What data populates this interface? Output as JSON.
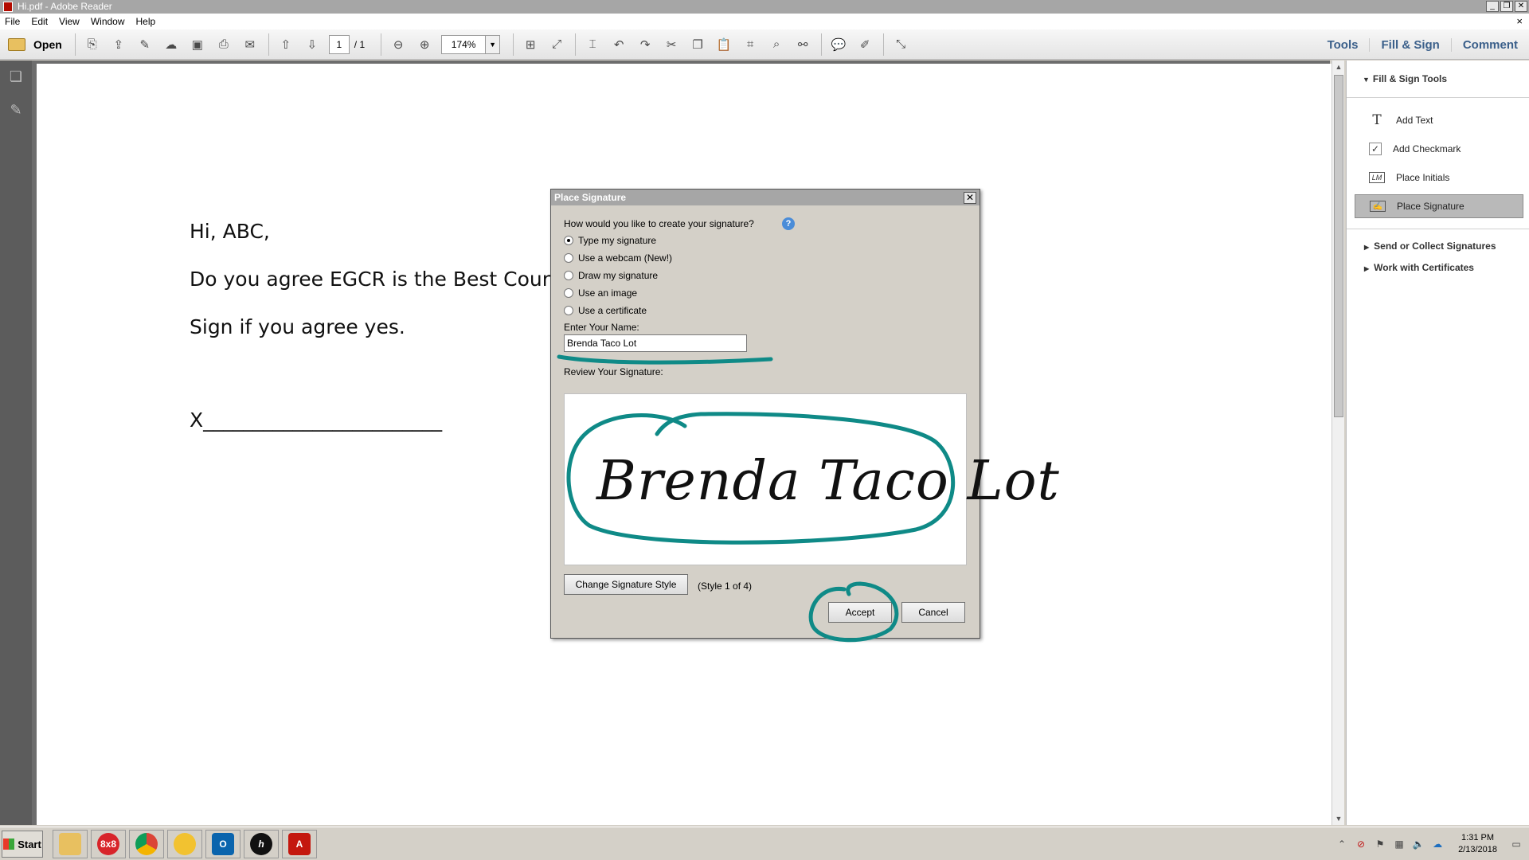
{
  "window": {
    "title": "Hi.pdf - Adobe Reader"
  },
  "menu": {
    "items": [
      "File",
      "Edit",
      "View",
      "Window",
      "Help"
    ],
    "close_doc": "×"
  },
  "toolbar": {
    "open_label": "Open",
    "page_current": "1",
    "page_total": "/ 1",
    "zoom": "174%",
    "tabs": [
      "Tools",
      "Fill & Sign",
      "Comment"
    ]
  },
  "document": {
    "lines": [
      "Hi, ABC,",
      "Do you agree EGCR is the Best Court R",
      "Sign if you agree yes.",
      "X________________________"
    ]
  },
  "right_pane": {
    "header": "Fill & Sign Tools",
    "items": [
      "Add Text",
      "Add Checkmark",
      "Place Initials",
      "Place Signature"
    ],
    "sections": [
      "Send or Collect Signatures",
      "Work with Certificates"
    ]
  },
  "dialog": {
    "title": "Place Signature",
    "question": "How would you like to create your signature?",
    "options": [
      "Type my signature",
      "Use a webcam (New!)",
      "Draw my signature",
      "Use an image",
      "Use a certificate"
    ],
    "selected_option": 0,
    "name_label": "Enter Your Name:",
    "name_value": "Brenda Taco Lot",
    "review_label": "Review Your Signature:",
    "signature_text": "Brenda Taco Lot",
    "change_style_label": "Change Signature Style",
    "style_indicator": "(Style 1 of 4)",
    "accept_label": "Accept",
    "cancel_label": "Cancel"
  },
  "taskbar": {
    "start_label": "Start",
    "apps": [
      "file-explorer",
      "8x8",
      "chrome",
      "messenger",
      "outlook",
      "hp",
      "adobe-reader"
    ],
    "app_label_8x8": "8x8",
    "clock_time": "1:31 PM",
    "clock_date": "2/13/2018"
  },
  "annotation_color": "#0f8a87"
}
